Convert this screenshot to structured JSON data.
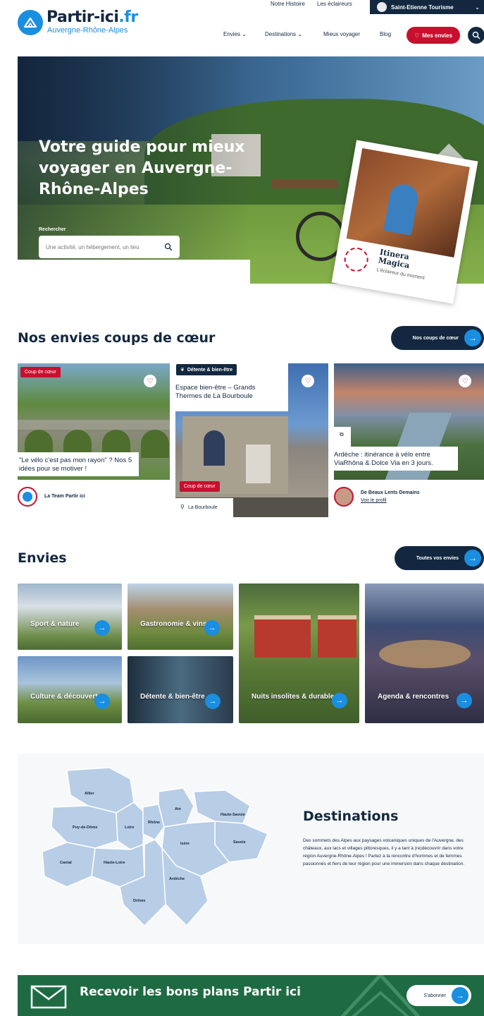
{
  "header": {
    "top_links": [
      "Notre Histoire",
      "Les éclaireurs"
    ],
    "office_button": "Saint-Etienne Tourisme",
    "logo_title": "Partir-ici",
    "logo_tld": ".fr",
    "logo_subtitle": "Auvergne-Rhône-Alpes",
    "nav": [
      "Envies",
      "Destinations",
      "Mieux voyager",
      "Blog"
    ],
    "my_envies": "Mes envies"
  },
  "hero": {
    "title": "Votre guide pour mieux voyager en Auvergne-Rhône-Alpes",
    "search_label": "Rechercher",
    "search_placeholder": "Une activité, un hébergement, un lieu",
    "polaroid_name_1": "Itinera",
    "polaroid_name_2": "Magica",
    "polaroid_tag": "L'éclaireur du moment",
    "polaroid_stamp": "ÉCLAIREUR Partir ici"
  },
  "coups": {
    "title": "Nos envies coups de cœur",
    "button": "Nos coups de cœur",
    "cards": [
      {
        "badge": "Coup de cœur",
        "text": "\"Le vélo c'est pas mon rayon\" ? Nos 5 idées pour se motiver !",
        "author": "La Team Partir ici"
      },
      {
        "category": "Détente & bien-être",
        "text": "Espace bien-être – Grands Thermes de La Bourboule",
        "badge": "Coup de cœur",
        "location": "La Bourboule"
      },
      {
        "text": "Ardèche : itinérance à vélo entre ViaRhôna & Dolce Via en 3 jours.",
        "author": "De Beaux Lents Demains",
        "author_link": "Voir le profil"
      }
    ]
  },
  "envies": {
    "title": "Envies",
    "button": "Toutes vos envies",
    "tiles": [
      {
        "label": "Sport & nature"
      },
      {
        "label": "Gastronomie & vins"
      },
      {
        "label": "Culture & découverte"
      },
      {
        "label": "Détente & bien-être"
      },
      {
        "label": "Nuits insolites & durables"
      },
      {
        "label": "Agenda & rencontres"
      }
    ]
  },
  "destinations": {
    "title": "Destinations",
    "text": "Des sommets des Alpes aux paysages volcaniques uniques de l'Auvergne, des châteaux, aux lacs et villages pittoresques, il y a tant à (re)découvrir dans votre région Auvergne-Rhône-Alpes ! Partez à la rencontre d'hommes et de femmes passionnés et fiers de leur région pour une immersion dans chaque destination.",
    "map_labels": [
      "Allier",
      "Puy-de-Dôme",
      "Loire",
      "Rhône",
      "Ain",
      "Haute-Savoie",
      "Savoie",
      "Isère",
      "Cantal",
      "Haute-Loire",
      "Drôme",
      "Ardèche"
    ]
  },
  "newsletter": {
    "title": "Recevoir les bons plans Partir ici",
    "button": "S'abonner"
  },
  "colors": {
    "navy": "#132840",
    "blue": "#1a8ee0",
    "red": "#c8102e",
    "green": "#1e6b43",
    "map": "#b8cde6"
  }
}
